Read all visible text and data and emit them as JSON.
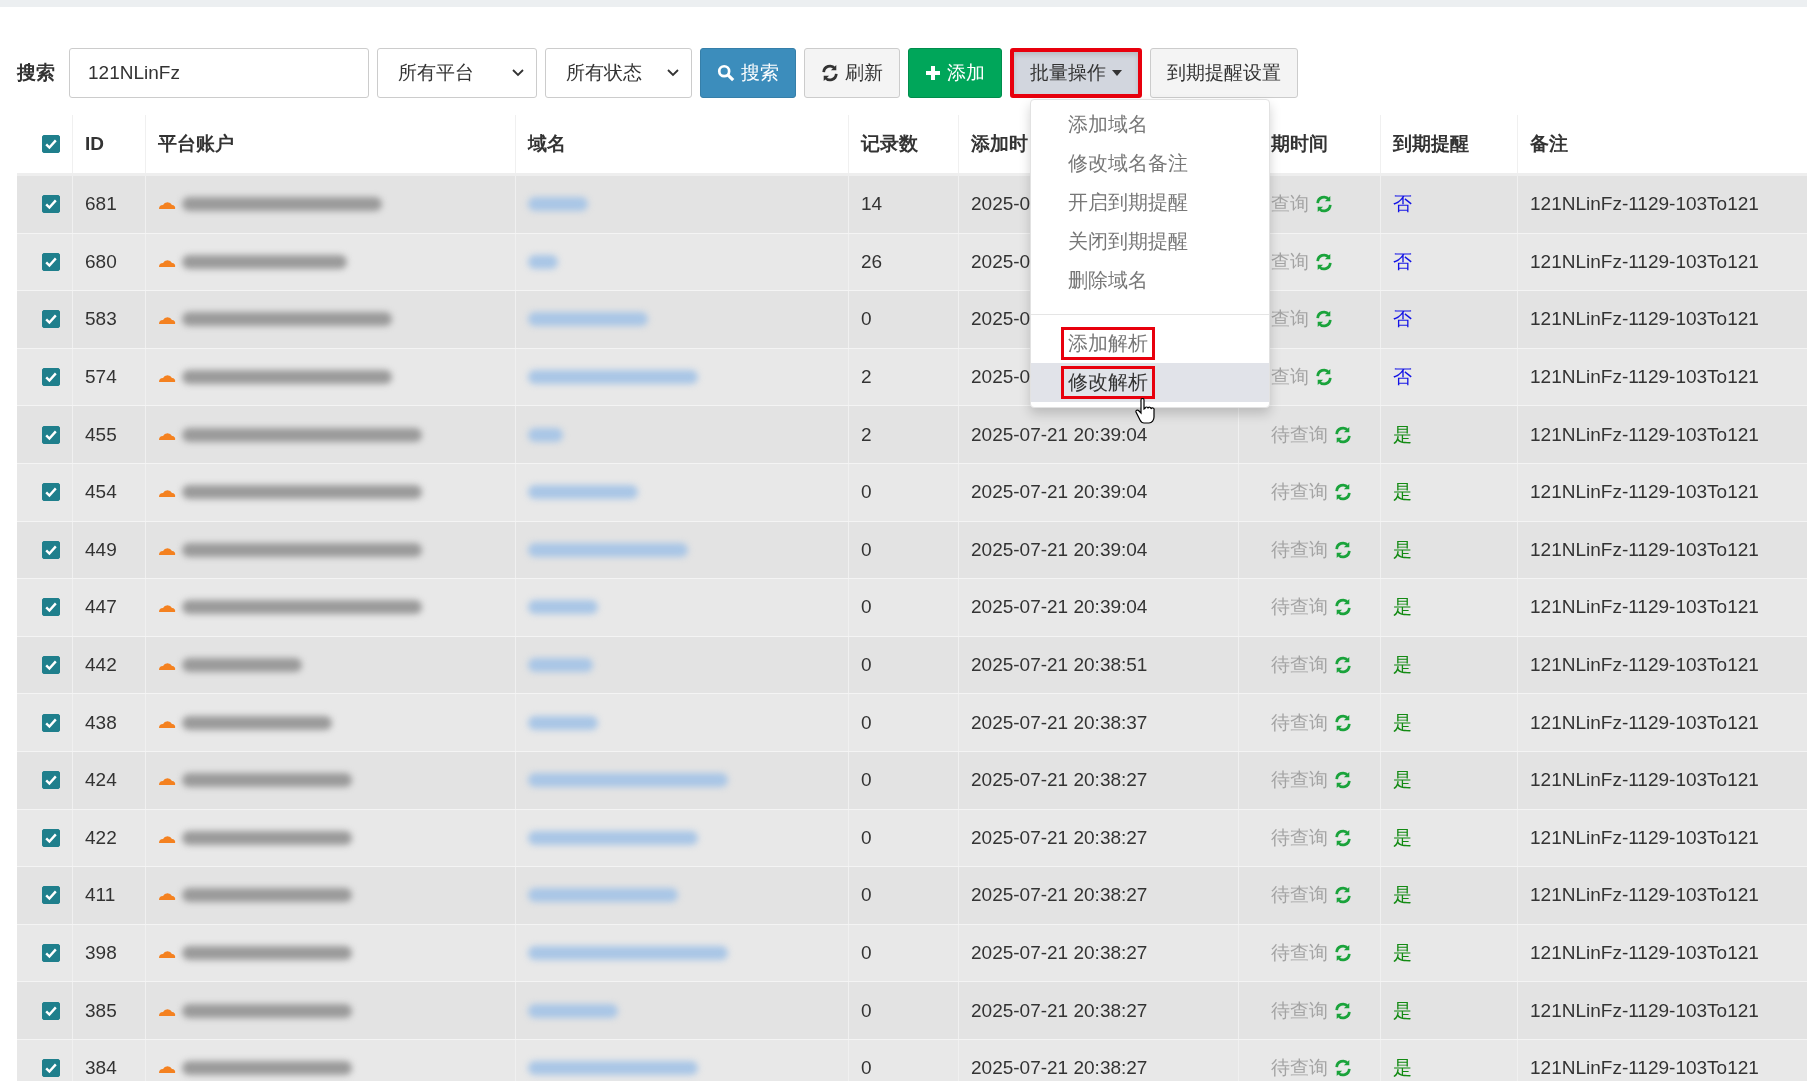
{
  "toolbar": {
    "search_label": "搜索",
    "search": {
      "value": "121NLinFz"
    },
    "selects": [
      "所有平台",
      "所有状态"
    ],
    "buttons": [
      {
        "kind": "search",
        "label": "搜索"
      },
      {
        "kind": "refresh",
        "label": "刷新"
      },
      {
        "kind": "add",
        "label": "添加"
      },
      {
        "kind": "dropdown",
        "label": "批量操作",
        "highlighted": true,
        "expanded": true
      },
      {
        "kind": "plain",
        "label": "到期提醒设置"
      }
    ]
  },
  "menu": {
    "groups": [
      [
        {
          "label": "添加域名",
          "hovered": false,
          "highlighted": false
        },
        {
          "label": "修改域名备注",
          "hovered": false,
          "highlighted": false
        },
        {
          "label": "开启到期提醒",
          "hovered": false,
          "highlighted": false
        },
        {
          "label": "关闭到期提醒",
          "hovered": false,
          "highlighted": false
        },
        {
          "label": "删除域名",
          "hovered": false,
          "highlighted": false
        }
      ],
      [
        {
          "label": "添加解析",
          "hovered": false,
          "highlighted": true
        },
        {
          "label": "修改解析",
          "hovered": true,
          "highlighted": true
        }
      ]
    ]
  },
  "table": {
    "all_checked": true,
    "columns": [
      "ID",
      "平台账户",
      "域名",
      "记录数",
      "添加时",
      "期时间",
      "到期提醒",
      "备注"
    ],
    "rows": [
      {
        "checked": true,
        "id": "681",
        "records": "14",
        "added": "2025-0",
        "expiry": "查询",
        "reminder": {
          "text": "否",
          "on": false
        },
        "note": "121NLinFz-1129-103To121"
      },
      {
        "checked": true,
        "id": "680",
        "records": "26",
        "added": "2025-0",
        "expiry": "查询",
        "reminder": {
          "text": "否",
          "on": false
        },
        "note": "121NLinFz-1129-103To121"
      },
      {
        "checked": true,
        "id": "583",
        "records": "0",
        "added": "2025-0",
        "expiry": "查询",
        "reminder": {
          "text": "否",
          "on": false
        },
        "note": "121NLinFz-1129-103To121"
      },
      {
        "checked": true,
        "id": "574",
        "records": "2",
        "added": "2025-0",
        "expiry": "查询",
        "reminder": {
          "text": "否",
          "on": false
        },
        "note": "121NLinFz-1129-103To121"
      },
      {
        "checked": true,
        "id": "455",
        "records": "2",
        "added": "2025-07-21 20:39:04",
        "expiry": "待查询",
        "reminder": {
          "text": "是",
          "on": true
        },
        "note": "121NLinFz-1129-103To121"
      },
      {
        "checked": true,
        "id": "454",
        "records": "0",
        "added": "2025-07-21 20:39:04",
        "expiry": "待查询",
        "reminder": {
          "text": "是",
          "on": true
        },
        "note": "121NLinFz-1129-103To121"
      },
      {
        "checked": true,
        "id": "449",
        "records": "0",
        "added": "2025-07-21 20:39:04",
        "expiry": "待查询",
        "reminder": {
          "text": "是",
          "on": true
        },
        "note": "121NLinFz-1129-103To121"
      },
      {
        "checked": true,
        "id": "447",
        "records": "0",
        "added": "2025-07-21 20:39:04",
        "expiry": "待查询",
        "reminder": {
          "text": "是",
          "on": true
        },
        "note": "121NLinFz-1129-103To121"
      },
      {
        "checked": true,
        "id": "442",
        "records": "0",
        "added": "2025-07-21 20:38:51",
        "expiry": "待查询",
        "reminder": {
          "text": "是",
          "on": true
        },
        "note": "121NLinFz-1129-103To121"
      },
      {
        "checked": true,
        "id": "438",
        "records": "0",
        "added": "2025-07-21 20:38:37",
        "expiry": "待查询",
        "reminder": {
          "text": "是",
          "on": true
        },
        "note": "121NLinFz-1129-103To121"
      },
      {
        "checked": true,
        "id": "424",
        "records": "0",
        "added": "2025-07-21 20:38:27",
        "expiry": "待查询",
        "reminder": {
          "text": "是",
          "on": true
        },
        "note": "121NLinFz-1129-103To121"
      },
      {
        "checked": true,
        "id": "422",
        "records": "0",
        "added": "2025-07-21 20:38:27",
        "expiry": "待查询",
        "reminder": {
          "text": "是",
          "on": true
        },
        "note": "121NLinFz-1129-103To121"
      },
      {
        "checked": true,
        "id": "411",
        "records": "0",
        "added": "2025-07-21 20:38:27",
        "expiry": "待查询",
        "reminder": {
          "text": "是",
          "on": true
        },
        "note": "121NLinFz-1129-103To121"
      },
      {
        "checked": true,
        "id": "398",
        "records": "0",
        "added": "2025-07-21 20:38:27",
        "expiry": "待查询",
        "reminder": {
          "text": "是",
          "on": true
        },
        "note": "121NLinFz-1129-103To121"
      },
      {
        "checked": true,
        "id": "385",
        "records": "0",
        "added": "2025-07-21 20:38:27",
        "expiry": "待查询",
        "reminder": {
          "text": "是",
          "on": true
        },
        "note": "121NLinFz-1129-103To121"
      },
      {
        "checked": true,
        "id": "384",
        "records": "0",
        "added": "2025-07-21 20:38:27",
        "expiry": "待查询",
        "reminder": {
          "text": "是",
          "on": true
        },
        "note": "121NLinFz-1129-103To121"
      }
    ]
  }
}
